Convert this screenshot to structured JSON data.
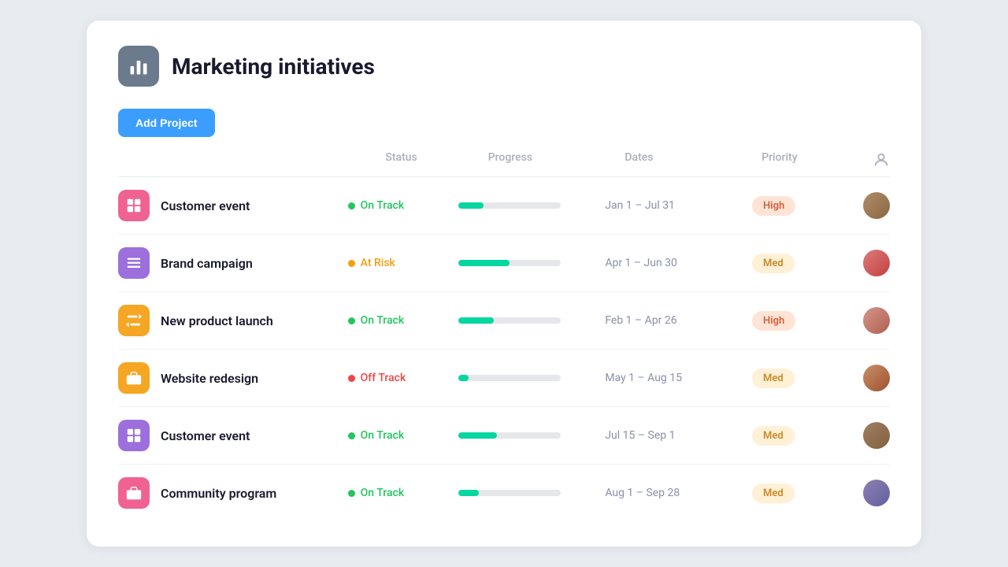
{
  "header": {
    "title": "Marketing initiatives",
    "icon_label": "chart-bar-icon"
  },
  "toolbar": {
    "add_button_label": "Add Project",
    "user_icon_label": "user-icon"
  },
  "table": {
    "columns": [
      "",
      "Status",
      "Progress",
      "Dates",
      "Priority",
      ""
    ],
    "rows": [
      {
        "id": 1,
        "name": "Customer event",
        "icon_color": "#f06292",
        "icon_type": "grid-icon",
        "status": "On Track",
        "status_type": "on-track",
        "progress": 25,
        "dates": "Jan 1 – Jul 31",
        "priority": "High",
        "priority_type": "high",
        "avatar_label": "av1"
      },
      {
        "id": 2,
        "name": "Brand campaign",
        "icon_color": "#9c6fdc",
        "icon_type": "list-icon",
        "status": "At Risk",
        "status_type": "at-risk",
        "progress": 50,
        "dates": "Apr 1 – Jun 30",
        "priority": "Med",
        "priority_type": "med",
        "avatar_label": "av2"
      },
      {
        "id": 3,
        "name": "New product launch",
        "icon_color": "#f5a623",
        "icon_type": "transfer-icon",
        "status": "On Track",
        "status_type": "on-track",
        "progress": 35,
        "dates": "Feb 1 – Apr 26",
        "priority": "High",
        "priority_type": "high",
        "avatar_label": "av3"
      },
      {
        "id": 4,
        "name": "Website redesign",
        "icon_color": "#f5a623",
        "icon_type": "briefcase-icon",
        "status": "Off Track",
        "status_type": "off-track",
        "progress": 10,
        "dates": "May 1 – Aug 15",
        "priority": "Med",
        "priority_type": "med",
        "avatar_label": "av4"
      },
      {
        "id": 5,
        "name": "Customer event",
        "icon_color": "#9c6fdc",
        "icon_type": "grid-icon",
        "status": "On Track",
        "status_type": "on-track",
        "progress": 38,
        "dates": "Jul 15 – Sep 1",
        "priority": "Med",
        "priority_type": "med",
        "avatar_label": "av5"
      },
      {
        "id": 6,
        "name": "Community program",
        "icon_color": "#f06292",
        "icon_type": "briefcase-icon",
        "status": "On Track",
        "status_type": "on-track",
        "progress": 20,
        "dates": "Aug 1 – Sep 28",
        "priority": "Med",
        "priority_type": "med",
        "avatar_label": "av6"
      }
    ]
  }
}
